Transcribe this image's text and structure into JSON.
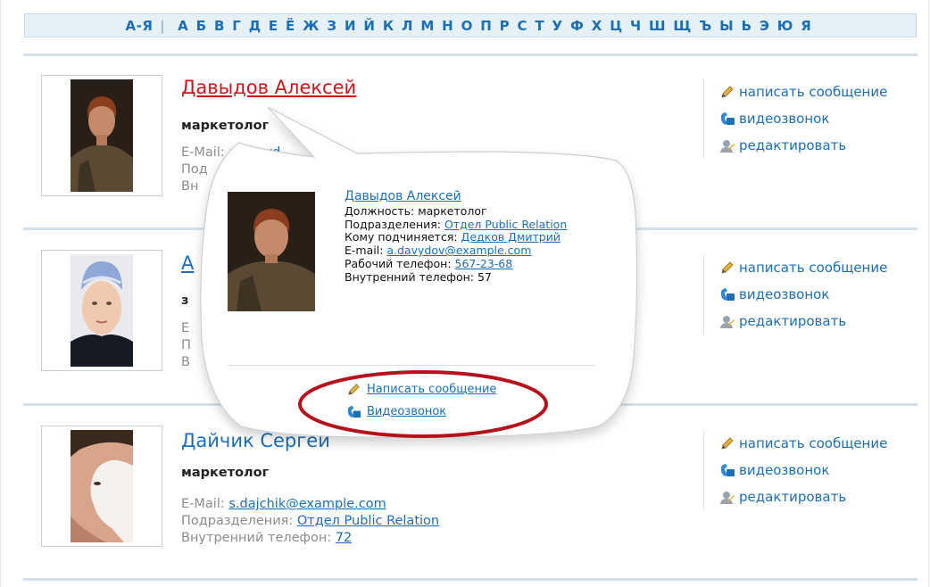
{
  "alphabet": {
    "all_label": "А-Я",
    "letters": [
      "А",
      "Б",
      "В",
      "Г",
      "Д",
      "Е",
      "Ё",
      "Ж",
      "З",
      "И",
      "Й",
      "К",
      "Л",
      "М",
      "Н",
      "О",
      "П",
      "Р",
      "С",
      "Т",
      "У",
      "Ф",
      "Х",
      "Ц",
      "Ч",
      "Ш",
      "Щ",
      "Ъ",
      "Ы",
      "Ь",
      "Э",
      "Ю",
      "Я"
    ]
  },
  "actions": {
    "send_message": "написать сообщение",
    "video_call": "видеозвонок",
    "edit": "редактировать"
  },
  "people": [
    {
      "name": "Давыдов Алексей",
      "position": "маркетолог",
      "email_label": "E-Mail:",
      "email": "a.davyd",
      "dept_label": "Под",
      "phone_label": "Вн"
    },
    {
      "name": "А",
      "position": "з",
      "line1": "Е",
      "line2": "П",
      "line3": "В"
    },
    {
      "name": "Дайчик Сергей",
      "position": "маркетолог",
      "email_label": "E-Mail:",
      "email": "s.dajchik@example.com",
      "dept_label": "Подразделения:",
      "dept": "Отдел Public Relation",
      "phone_label": "Внутренний телефон:",
      "phone": "72"
    }
  ],
  "tooltip": {
    "name": "Давыдов Алексей",
    "position_label": "Должность:",
    "position": "маркетолог",
    "dept_label": "Подразделения:",
    "dept": "Отдел Public Relation",
    "manager_label": "Кому подчиняется:",
    "manager": "Дедков Дмитрий",
    "email_label": "E-mail:",
    "email": "a.davydov@example.com",
    "work_phone_label": "Рабочий телефон:",
    "work_phone": "567-23-68",
    "internal_phone_label": "Внутренний телефон:",
    "internal_phone": "57",
    "send_message": "Написать сообщение",
    "video_call": "Видеозвонок"
  },
  "colors": {
    "accent": "#1b6fb8",
    "name_hover": "#c8161b",
    "highlight": "#b5121b"
  }
}
